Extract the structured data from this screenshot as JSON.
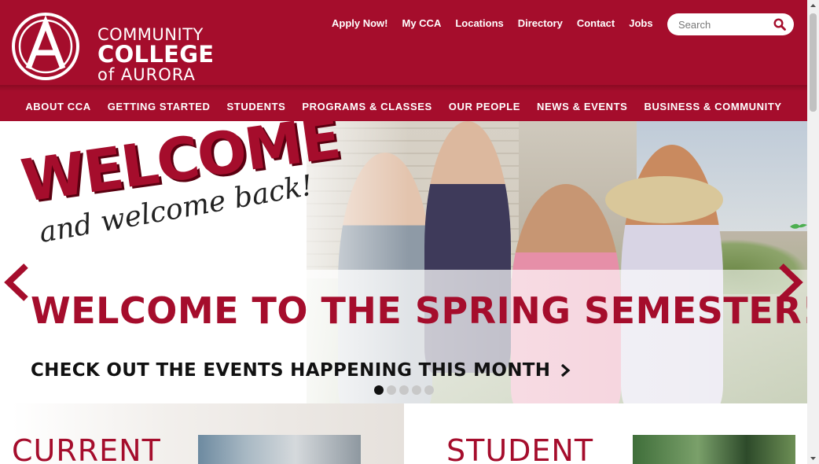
{
  "header": {
    "logo": {
      "line1": "COMMUNITY",
      "line2": "COLLEGE",
      "line3": "of AURORA"
    },
    "utility_nav": [
      "Apply Now!",
      "My CCA",
      "Locations",
      "Directory",
      "Contact",
      "Jobs"
    ],
    "search": {
      "placeholder": "Search",
      "icon": "search-icon"
    }
  },
  "main_nav": [
    "ABOUT CCA",
    "GETTING STARTED",
    "STUDENTS",
    "PROGRAMS & CLASSES",
    "OUR PEOPLE",
    "NEWS & EVENTS",
    "BUSINESS & COMMUNITY"
  ],
  "hero": {
    "art_word": "WELCOME",
    "art_sub": "and welcome back!",
    "headline": "WELCOME TO THE SPRING SEMESTER!",
    "subline": "CHECK OUT THE EVENTS HAPPENING THIS MONTH",
    "slides": {
      "count": 5,
      "active": 1
    },
    "prev_icon": "chevron-left-icon",
    "next_icon": "chevron-right-icon"
  },
  "cards": {
    "left_title": "CURRENT",
    "right_title": "STUDENT"
  },
  "colors": {
    "brand": "#a50d2c",
    "text_dark": "#111111",
    "white": "#ffffff"
  }
}
